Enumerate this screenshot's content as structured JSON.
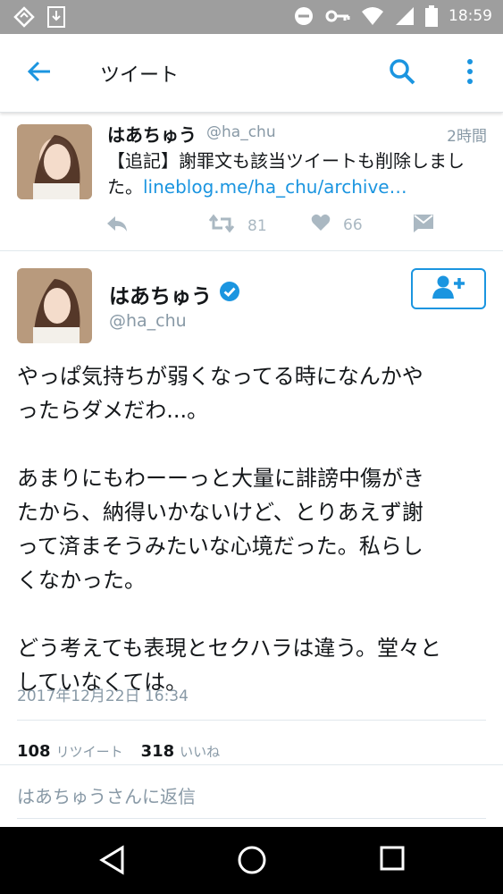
{
  "status_bar": {
    "time": "18:59"
  },
  "app_bar": {
    "title": "ツイート"
  },
  "previous_tweet": {
    "display_name": "はあちゅう",
    "handle": "@ha_chu",
    "time_ago": "2時間",
    "text_line1": "【追記】謝罪文も該当ツイートも削除しまし",
    "text_line2_prefix": "た。",
    "link_text": "lineblog.me/ha_chu/archive…",
    "retweet_count": "81",
    "like_count": "66"
  },
  "tweet": {
    "display_name": "はあちゅう",
    "handle": "@ha_chu",
    "body": "やっぱ気持ちが弱くなってる時になんかや\nったらダメだわ...。\n\nあまりにもわーーっと大量に誹謗中傷がき\nたから、納得いかないけど、とりあえず謝\nって済まそうみたいな心境だった。私らし\nくなかった。\n\nどう考えても表現とセクハラは違う。堂々と\nしていなくては。",
    "timestamp": "2017年12月22日 16:34",
    "retweets": "108",
    "retweets_label": "リツイート",
    "likes": "318",
    "likes_label": "いいね",
    "reply_placeholder": "はあちゅうさんに返信"
  },
  "colors": {
    "accent": "#1b95e0",
    "muted": "#8899a6",
    "icon": "#aab8c2"
  },
  "icons": [
    "back-arrow-icon",
    "search-icon",
    "more-vert-icon",
    "reply-icon",
    "retweet-icon",
    "heart-icon",
    "dm-icon",
    "verified-badge-icon",
    "follow-user-icon",
    "nav-back-icon",
    "nav-home-icon",
    "nav-recents-icon"
  ]
}
